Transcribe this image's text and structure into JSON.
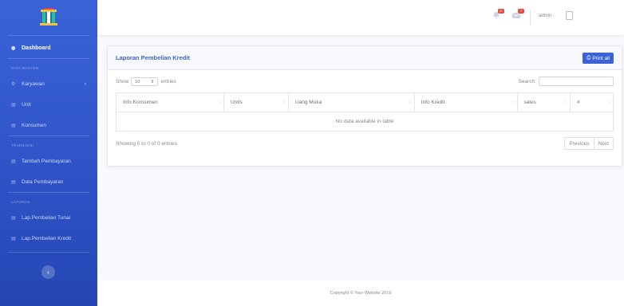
{
  "sidebar": {
    "dashboard": "Dashboard",
    "heading_master": "DATA MASTER",
    "karyawan": "Karyawan",
    "unit": "Unit",
    "konsumen": "Konsumen",
    "heading_transaksi": "TRANSAKSI",
    "tambah_pembayaran": "Tambah Pembayaran",
    "data_pembayaran": "Data Pembayaran",
    "heading_laporan": "LAPORAN",
    "lap_tunai": "Lap.Pembelian Tunai",
    "lap_kredit": "Lap.Pembelian Kredit",
    "toggle_icon": "chevron-left-icon"
  },
  "topbar": {
    "alerts_badge": "3+",
    "messages_badge": "7",
    "user_name": "admin"
  },
  "card": {
    "title": "Laporan Pembelian Kredit",
    "print_label": "Print all",
    "show_label": "Show",
    "entries_value": "10",
    "entries_label": "entries",
    "search_label": "Search:",
    "columns": [
      "Info Konsumen",
      "Units",
      "Uang Muka",
      "Info Kredit",
      "sales",
      "#"
    ],
    "empty_message": "No data available in table",
    "info_text": "Showing 0 to 0 of 0 entries",
    "prev_label": "Previous",
    "next_label": "Next"
  },
  "footer": {
    "copyright": "Copyright © Your Website 2019"
  },
  "colors": {
    "primary": "#3a63d8",
    "danger": "#e74a3b"
  }
}
